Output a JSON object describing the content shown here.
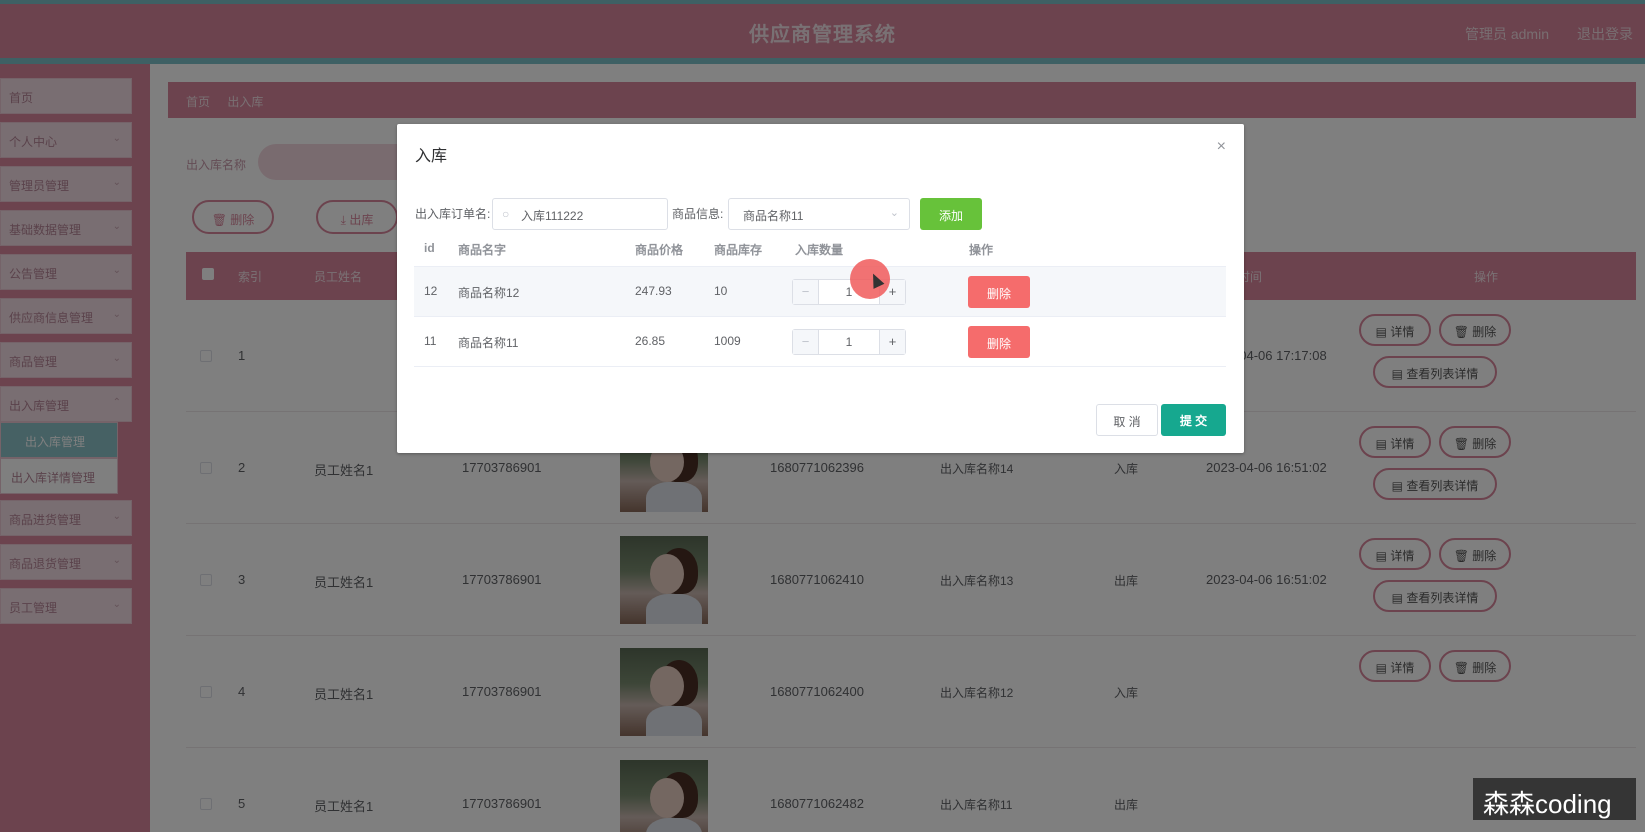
{
  "header": {
    "title": "供应商管理系统",
    "user": "管理员 admin",
    "logout": "退出登录"
  },
  "sidebar": {
    "items": [
      {
        "label": "首页"
      },
      {
        "label": "个人中心"
      },
      {
        "label": "管理员管理"
      },
      {
        "label": "基础数据管理"
      },
      {
        "label": "公告管理"
      },
      {
        "label": "供应商信息管理"
      },
      {
        "label": "商品管理"
      },
      {
        "label": "出入库管理"
      },
      {
        "label": "出入库管理"
      },
      {
        "label": "出入库详情管理"
      },
      {
        "label": "商品进货管理"
      },
      {
        "label": "商品退货管理"
      },
      {
        "label": "员工管理"
      }
    ]
  },
  "breadcrumb": {
    "home": "首页",
    "current": "出入库"
  },
  "filter": {
    "label": "出入库名称"
  },
  "toolbar": {
    "delete_label": "删除",
    "out_label": "出库"
  },
  "table": {
    "headers": {
      "index": "索引",
      "name": "员工姓名",
      "time": "添加时间",
      "ops": "操作"
    },
    "rows": [
      {
        "idx": "1",
        "name": "",
        "phone": "",
        "code": "",
        "store": "",
        "type": "",
        "time": "2023-04-06 17:17:08"
      },
      {
        "idx": "2",
        "name": "员工姓名1",
        "phone": "17703786901",
        "code": "1680771062396",
        "store": "出入库名称14",
        "type": "入库",
        "time": "2023-04-06 16:51:02"
      },
      {
        "idx": "3",
        "name": "员工姓名1",
        "phone": "17703786901",
        "code": "1680771062410",
        "store": "出入库名称13",
        "type": "出库",
        "time": "2023-04-06 16:51:02"
      },
      {
        "idx": "4",
        "name": "员工姓名1",
        "phone": "17703786901",
        "code": "1680771062400",
        "store": "出入库名称12",
        "type": "入库",
        "time": ""
      },
      {
        "idx": "5",
        "name": "员工姓名1",
        "phone": "17703786901",
        "code": "1680771062482",
        "store": "出入库名称11",
        "type": "出库",
        "time": ""
      }
    ],
    "ops": {
      "detail": "详情",
      "delete": "删除",
      "list_detail": "查看列表详情"
    }
  },
  "dialog": {
    "title": "入库",
    "close": "×",
    "order_label": "出入库订单名:",
    "order_value": "入库111222",
    "goods_label": "商品信息:",
    "goods_selected": "商品名称11",
    "add_label": "添加",
    "columns": [
      "id",
      "商品名字",
      "商品价格",
      "商品库存",
      "入库数量",
      "操作"
    ],
    "rows": [
      {
        "id": "12",
        "name": "商品名称12",
        "price": "247.93",
        "stock": "10",
        "qty": "1",
        "del": "删除"
      },
      {
        "id": "11",
        "name": "商品名称11",
        "price": "26.85",
        "stock": "1009",
        "qty": "1",
        "del": "删除"
      }
    ],
    "cancel_label": "取 消",
    "submit_label": "提 交"
  },
  "watermark": "森森coding",
  "colors": {
    "brand_pink": "#d8869c",
    "accent_teal": "#7cc0c8",
    "submit_green": "#16a88f",
    "add_green": "#67c23a",
    "danger_red": "#f56c6c"
  }
}
